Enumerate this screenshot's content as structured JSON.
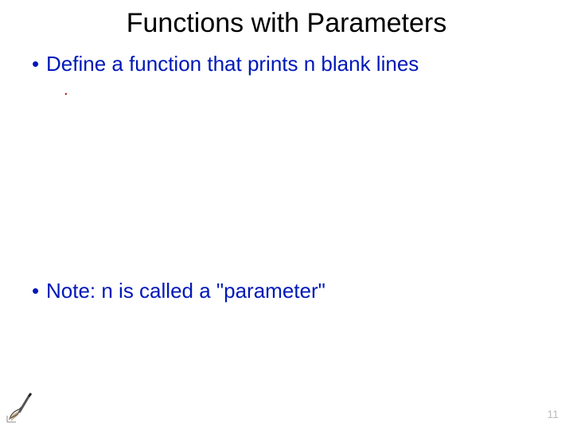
{
  "slide": {
    "title": "Functions with Parameters",
    "bullets": [
      {
        "marker": "•",
        "text": "Define a function that prints n blank lines"
      },
      {
        "marker": "•",
        "text": "Note: n is called a \"parameter\""
      }
    ],
    "sub_marker": ".",
    "page_number": "11"
  }
}
